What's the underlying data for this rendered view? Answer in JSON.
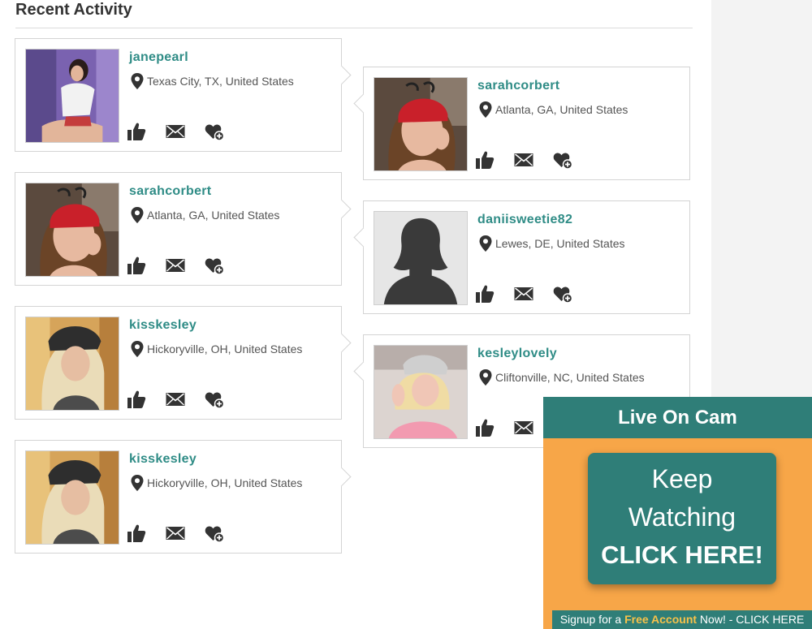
{
  "section": {
    "title": "Recent Activity"
  },
  "cards": [
    {
      "username": "janepearl",
      "location": "Texas City, TX, United States",
      "photo": "photo-janepearl"
    },
    {
      "username": "sarahcorbert",
      "location": "Atlanta, GA, United States",
      "photo": "photo-sarahcorbert"
    },
    {
      "username": "sarahcorbert",
      "location": "Atlanta, GA, United States",
      "photo": "photo-sarahcorbert"
    },
    {
      "username": "daniisweetie82",
      "location": "Lewes, DE, United States",
      "photo": "photo-silhouette-placeholder"
    },
    {
      "username": "kisskesley",
      "location": "Hickoryville, OH, United States",
      "photo": "photo-kisskesley"
    },
    {
      "username": "kesleylovely",
      "location": "Cliftonville, NC, United States",
      "photo": "photo-kesleylovely"
    },
    {
      "username": "kisskesley",
      "location": "Hickoryville, OH, United States",
      "photo": "photo-kisskesley"
    }
  ],
  "icons": {
    "location": "map-pin-icon",
    "like": "thumbs-up-icon",
    "message": "envelope-icon",
    "favorite": "heart-plus-icon"
  },
  "cam": {
    "header": "Live On Cam",
    "button_line1": "Keep",
    "button_line2": "Watching",
    "button_line3": "CLICK HERE!",
    "footer_prefix": "Signup for a ",
    "footer_highlight": "Free Account",
    "footer_suffix": " Now! - CLICK HERE"
  },
  "colors": {
    "accent_teal": "#2f7e78",
    "username_teal": "#2f8c86",
    "widget_orange": "#f7a648",
    "highlight_yellow": "#f7c24a",
    "icon_dark": "#333333"
  }
}
